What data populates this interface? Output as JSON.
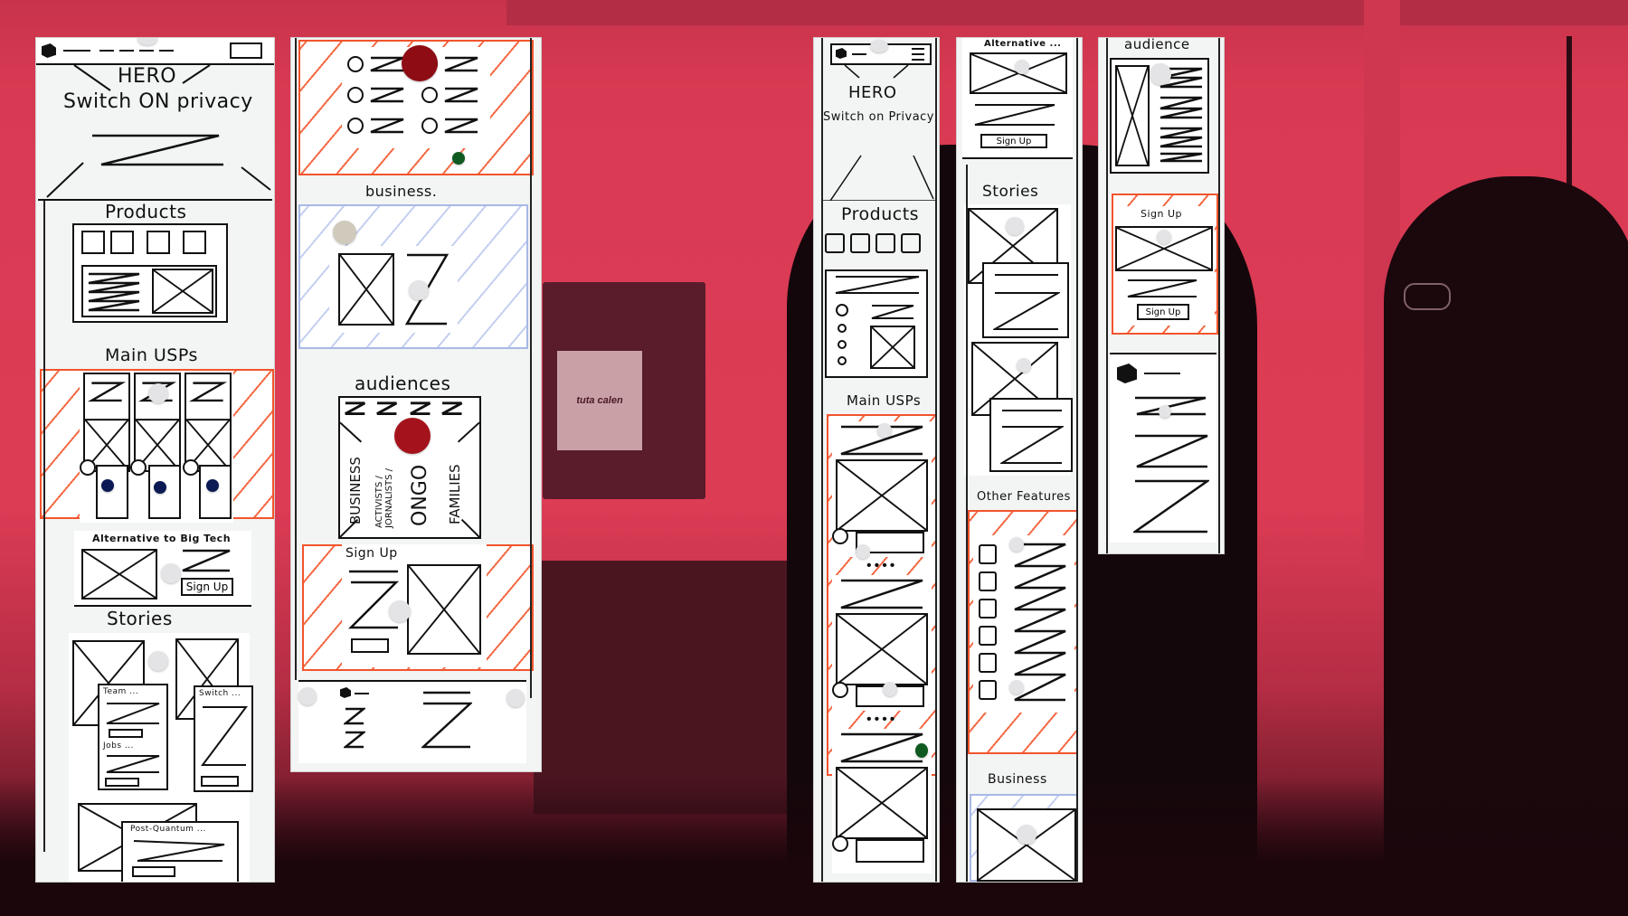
{
  "scene": {
    "description": "Photo of hand-drawn website wireframe strips on a whiteboard, red-tinted office background",
    "tint_color": "#d63a52",
    "monitor_text": "tuta calen"
  },
  "colors": {
    "ink": "#111111",
    "paper": "#ffffff",
    "whiteboard": "#f3f4f4",
    "hatch_red": "#f2542d",
    "hatch_blue": "#a8b8e6",
    "magnet_red": "#a4131c",
    "magnet_green": "#0f5a21",
    "magnet_navy": "#0b1a55"
  },
  "desktop_strip_1": {
    "hero_label": "HERO",
    "hero_tagline": "Switch ON privacy",
    "products_label": "Products",
    "main_usps_label": "Main USPs",
    "alternative_label": "Alternative to Big Tech",
    "alternative_button": "Sign Up",
    "stories_label": "Stories",
    "story_cards": [
      "Team ...",
      "Jobs ...",
      "Switch ...",
      "Post-Quantum ..."
    ]
  },
  "desktop_strip_2": {
    "business_label": "business.",
    "audiences_label": "audiences",
    "audience_columns": [
      "BUSINESS",
      "ACTIVISTS / JORNALISTS /",
      "ONGO",
      "FAMILIES"
    ],
    "signup_label": "Sign Up"
  },
  "mobile_strip_1": {
    "hero_label": "HERO",
    "hero_tagline": "Switch on Privacy",
    "products_label": "Products",
    "main_usps_label": "Main USPs"
  },
  "mobile_strip_2": {
    "alternative_label": "Alternative ...",
    "alternative_button": "Sign Up",
    "stories_label": "Stories",
    "other_features_label": "Other Features",
    "business_label": "Business"
  },
  "mobile_strip_3": {
    "audience_label": "audience",
    "signup_label": "Sign Up",
    "signup_button": "Sign Up"
  }
}
